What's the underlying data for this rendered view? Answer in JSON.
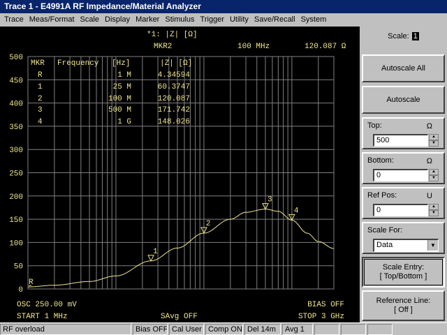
{
  "window": {
    "title": "Trace 1 - E4991A RF Impedance/Material Analyzer"
  },
  "menu": [
    "Trace",
    "Meas/Format",
    "Scale",
    "Display",
    "Marker",
    "Stimulus",
    "Trigger",
    "Utility",
    "Save/Recall",
    "System"
  ],
  "screen": {
    "trace_label": "*1: |Z| [Ω]",
    "active_marker_name": "MKR2",
    "active_marker_freq": "100 MHz",
    "active_marker_value": "120.087 Ω",
    "marker_table": {
      "headers": [
        "MKR",
        "Frequency",
        "[Hz]",
        "|Z| [Ω]"
      ],
      "rows": [
        [
          "R",
          "1 M",
          "4.34594"
        ],
        [
          "1",
          "25 M",
          "60.3747"
        ],
        [
          "2",
          "100 M",
          "120.087"
        ],
        [
          "3",
          "500 M",
          "171.742"
        ],
        [
          "4",
          "1 G",
          "148.026"
        ]
      ]
    },
    "osc": "OSC 250.00 mV",
    "bias": "BIAS OFF",
    "start": "START  1 MHz",
    "savg": "SAvg OFF",
    "stop": "STOP  3 GHz"
  },
  "chart_data": {
    "type": "line",
    "xscale": "log",
    "xlim": [
      1000000,
      3000000000
    ],
    "ylim": [
      0,
      500
    ],
    "yticks": [
      0,
      50,
      100,
      150,
      200,
      250,
      300,
      350,
      400,
      450,
      500
    ],
    "grid": true,
    "x": [
      1000000,
      2000000,
      5000000,
      10000000,
      25000000,
      50000000,
      100000000,
      200000000,
      300000000,
      500000000,
      700000000,
      1000000000,
      1500000000,
      2000000000,
      3000000000
    ],
    "y": [
      4.35,
      8,
      16,
      28,
      60.37,
      88,
      120.09,
      150,
      165,
      171.74,
      167,
      148.03,
      120,
      102,
      87
    ],
    "markers": [
      {
        "label": "R",
        "x": 1000000,
        "y": 4.35,
        "shape": "text"
      },
      {
        "label": "1",
        "x": 25000000,
        "y": 60.37,
        "shape": "triangle"
      },
      {
        "label": "2",
        "x": 100000000,
        "y": 120.09,
        "shape": "triangle"
      },
      {
        "label": "3",
        "x": 500000000,
        "y": 171.74,
        "shape": "triangle"
      },
      {
        "label": "4",
        "x": 1000000000,
        "y": 148.03,
        "shape": "triangle"
      }
    ]
  },
  "side": {
    "scale_label": "Scale:",
    "scale_value": "1",
    "autoscale_all": "Autoscale All",
    "autoscale": "Autoscale",
    "top_label": "Top:",
    "top_unit": "Ω",
    "top_value": "500",
    "bottom_label": "Bottom:",
    "bottom_unit": "Ω",
    "bottom_value": "0",
    "refpos_label": "Ref Pos:",
    "refpos_unit": "U",
    "refpos_value": "0",
    "scalefor_label": "Scale For:",
    "scalefor_value": "Data",
    "scale_entry_line1": "Scale Entry:",
    "scale_entry_line2": "[ Top/Bottom ]",
    "ref_line_line1": "Reference Line:",
    "ref_line_line2": "[ Off ]"
  },
  "status": [
    "RF overload",
    "Bias OFF",
    "Cal User",
    "Comp ON",
    "Del 14m",
    "Avg  1"
  ]
}
